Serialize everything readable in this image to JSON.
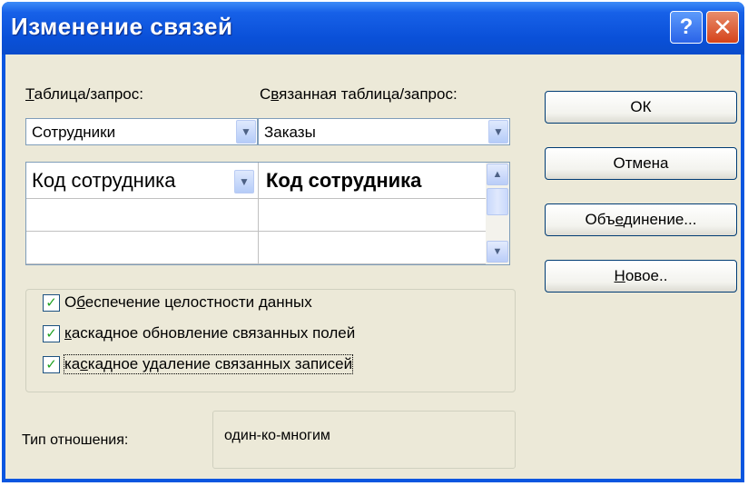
{
  "window": {
    "title": "Изменение связей",
    "help_button": "?",
    "close_button": "✕"
  },
  "table_label": "Таблица/запрос:",
  "table_label_accel": "Т",
  "table_label_rest": "аблица/запрос:",
  "related_label_prefix": "С",
  "related_label_accel": "в",
  "related_label_rest": "язанная таблица/запрос:",
  "table_value": "Сотрудники",
  "related_value": "Заказы",
  "grid": {
    "left_field": "Код сотрудника",
    "right_field": "Код сотрудника"
  },
  "options": [
    {
      "prefix": "О",
      "accel": "б",
      "rest": "еспечение целостности данных",
      "checked": true
    },
    {
      "prefix": "",
      "accel": "к",
      "rest": "аскадное обновление связанных полей",
      "checked": true
    },
    {
      "prefix": "ка",
      "accel": "с",
      "rest": "кадное удаление связанных записей",
      "checked": true
    }
  ],
  "buttons": {
    "ok": "ОК",
    "cancel": "Отмена",
    "join_prefix": "Объ",
    "join_accel": "е",
    "join_rest": "динение...",
    "new_accel": "Н",
    "new_rest": "овое.."
  },
  "relation_type_label": "Тип отношения:",
  "relation_type_value": "один-ко-многим"
}
